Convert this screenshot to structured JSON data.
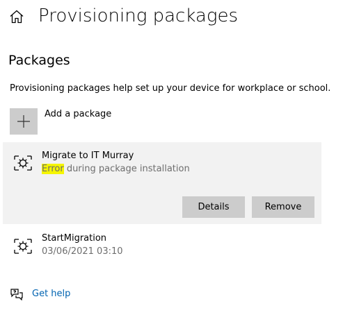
{
  "header": {
    "title": "Provisioning packages",
    "home_icon": "home-icon"
  },
  "section": {
    "title": "Packages",
    "description": "Provisioning packages help set up your device for workplace or school."
  },
  "add_package": {
    "label": "Add a package",
    "icon": "plus-icon"
  },
  "packages": [
    {
      "name": "Migrate to IT Murray",
      "status_highlight": "Error",
      "status_rest": " during package installation",
      "selected": true,
      "icon": "package-gear-icon",
      "buttons": {
        "details": "Details",
        "remove": "Remove"
      }
    },
    {
      "name": "StartMigration",
      "date": "03/06/2021 03:10",
      "selected": false,
      "icon": "package-gear-icon"
    }
  ],
  "help": {
    "label": "Get help",
    "icon": "help-chat-icon"
  },
  "colors": {
    "highlight": "#f5f500",
    "selected_bg": "#f2f2f2",
    "button_bg": "#cccccc",
    "link": "#0063b1",
    "secondary_text": "#6e6e6e"
  }
}
